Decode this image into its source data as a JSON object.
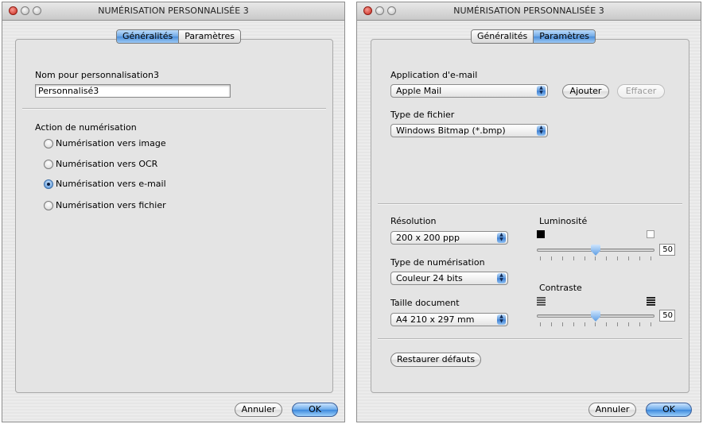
{
  "window_left": {
    "title": "NUMÉRISATION PERSONNALISÉE 3",
    "tabs": [
      "Généralités",
      "Paramètres"
    ],
    "active_tab": "Généralités",
    "name_label": "Nom pour personnalisation3",
    "name_value": "Personnalisé3",
    "action_label": "Action de numérisation",
    "radios": [
      {
        "label": "Numérisation vers image",
        "checked": false
      },
      {
        "label": "Numérisation vers OCR",
        "checked": false
      },
      {
        "label": "Numérisation vers e-mail",
        "checked": true
      },
      {
        "label": "Numérisation vers fichier",
        "checked": false
      }
    ],
    "cancel_label": "Annuler",
    "ok_label": "OK"
  },
  "window_right": {
    "title": "NUMÉRISATION PERSONNALISÉE 3",
    "tabs": [
      "Généralités",
      "Paramètres"
    ],
    "active_tab": "Paramètres",
    "email_app_label": "Application d'e-mail",
    "email_app_value": "Apple Mail",
    "add_label": "Ajouter",
    "delete_label": "Effacer",
    "file_type_label": "Type de fichier",
    "file_type_value": "Windows Bitmap (*.bmp)",
    "resolution_label": "Résolution",
    "resolution_value": "200 x 200 ppp",
    "scan_type_label": "Type de numérisation",
    "scan_type_value": "Couleur 24 bits",
    "doc_size_label": "Taille document",
    "doc_size_value": "A4 210 x 297 mm",
    "brightness_label": "Luminosité",
    "brightness_value": "50",
    "contrast_label": "Contraste",
    "contrast_value": "50",
    "restore_label": "Restaurer défauts",
    "cancel_label": "Annuler",
    "ok_label": "OK"
  },
  "icons": {
    "close": "close-traffic-light-icon",
    "minimize": "minimize-traffic-light-icon",
    "maximize": "zoom-traffic-light-icon",
    "popup_arrows": "updown-arrows-icon",
    "brightness_low": "black-square-icon",
    "brightness_high": "white-square-icon",
    "contrast_low": "low-contrast-lines-icon",
    "contrast_high": "high-contrast-lines-icon"
  },
  "colors": {
    "accent": "#4c8fdb",
    "close": "#c8261b",
    "window_bg": "#ececec"
  }
}
